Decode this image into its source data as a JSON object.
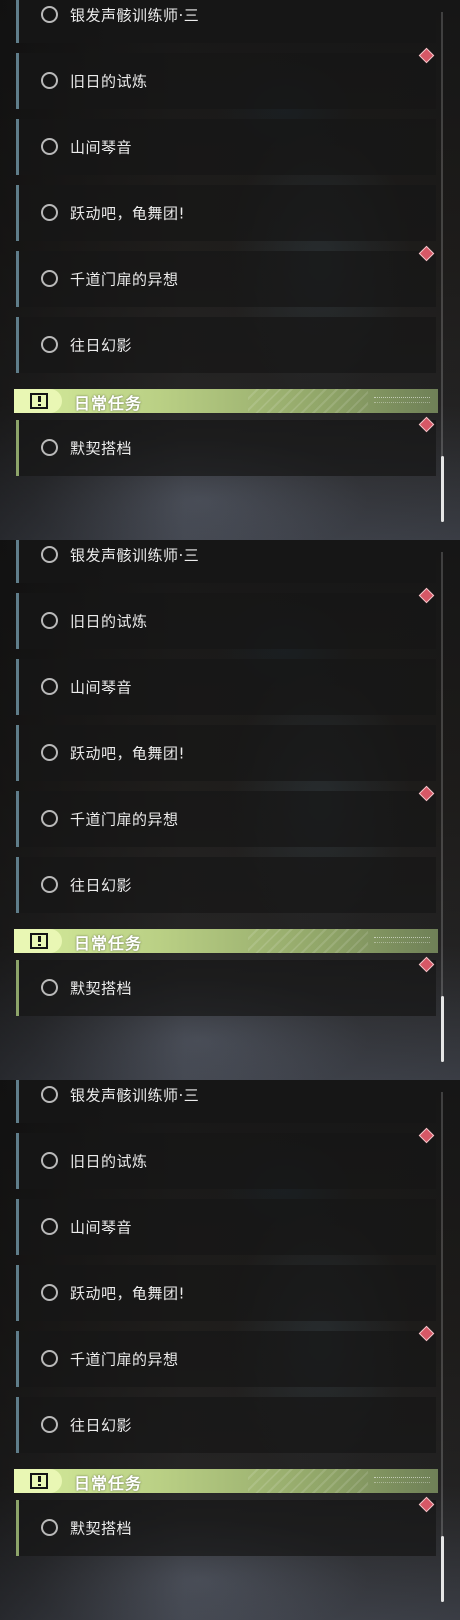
{
  "panels": [
    {
      "tasks": [
        "银发声骸训练师·三",
        "旧日的试炼",
        "山间琴音",
        "跃动吧，龟舞团!",
        "千道门扉的异想",
        "往日幻影"
      ],
      "section_title": "日常任务",
      "daily_task": "默契搭档"
    },
    {
      "tasks": [
        "银发声骸训练师·三",
        "旧日的试炼",
        "山间琴音",
        "跃动吧，龟舞团!",
        "千道门扉的异想",
        "往日幻影"
      ],
      "section_title": "日常任务",
      "daily_task": "默契搭档"
    },
    {
      "tasks": [
        "银发声骸训练师·三",
        "旧日的试炼",
        "山间琴音",
        "跃动吧，龟舞团!",
        "千道门扉的异想",
        "往日幻影"
      ],
      "section_title": "日常任务",
      "daily_task": "默契搭档"
    }
  ],
  "icons": {
    "task_status": "circle-outline-icon",
    "section": "exclamation-icon",
    "tracked_marker": "red-diamond-icon"
  },
  "colors": {
    "quest_accent": "#5f7d8a",
    "daily_accent": "#8da46a",
    "daily_header": "#c5dc8c",
    "marker": "#d65866"
  }
}
